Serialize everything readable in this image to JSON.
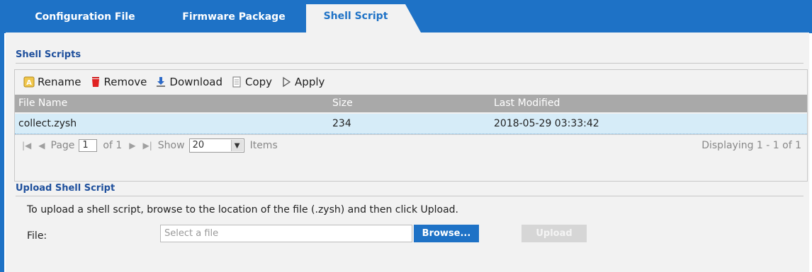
{
  "tabs": {
    "config_file": "Configuration File",
    "firmware_package": "Firmware Package",
    "shell_script": "Shell Script"
  },
  "shell_scripts": {
    "title": "Shell Scripts",
    "toolbar": {
      "rename": "Rename",
      "remove": "Remove",
      "download": "Download",
      "copy": "Copy",
      "apply": "Apply"
    },
    "columns": {
      "file_name": "File Name",
      "size": "Size",
      "last_modified": "Last Modified"
    },
    "rows": [
      {
        "file_name": "collect.zysh",
        "size": "234",
        "last_modified": "2018-05-29 03:33:42"
      }
    ],
    "pager": {
      "page_label": "Page",
      "page_value": "1",
      "of_label": "of 1",
      "show_label": "Show",
      "show_value": "20",
      "items_label": "Items",
      "displaying": "Displaying 1 - 1 of 1"
    }
  },
  "upload": {
    "title": "Upload Shell Script",
    "instructions": "To upload a shell script, browse to the location of the file (.zysh) and then click Upload.",
    "file_label": "File:",
    "file_placeholder": "Select a file",
    "browse_label": "Browse...",
    "upload_label": "Upload"
  },
  "colors": {
    "accent": "#1e72c6",
    "header_gray": "#a9a9a9",
    "selected_row": "#d6ecf8",
    "section_title": "#1e4f9c"
  },
  "icons": [
    "rename-icon",
    "trash-icon",
    "download-icon",
    "copy-icon",
    "play-icon",
    "first-page-icon",
    "prev-page-icon",
    "next-page-icon",
    "last-page-icon",
    "chevron-down-icon"
  ]
}
